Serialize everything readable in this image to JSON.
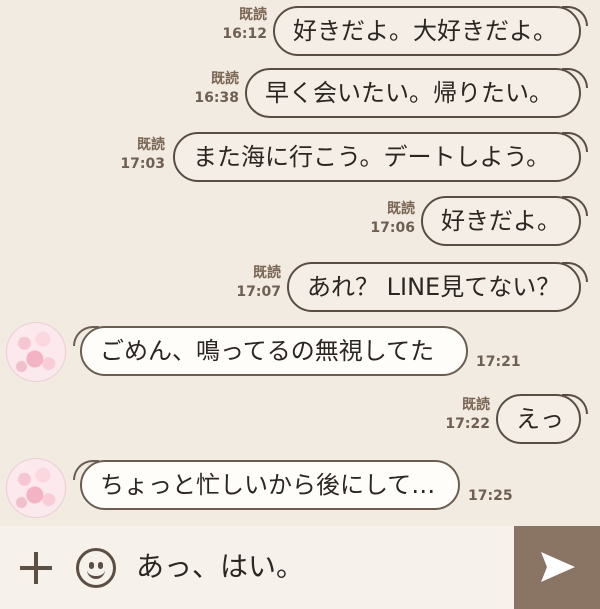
{
  "messages": [
    {
      "dir": "sent",
      "text": "好きだよ。大好きだよ。",
      "read": "既読",
      "time": "16:12"
    },
    {
      "dir": "sent",
      "text": "早く会いたい。帰りたい。",
      "read": "既読",
      "time": "16:38"
    },
    {
      "dir": "sent",
      "text": "また海に行こう。デートしよう。",
      "read": "既読",
      "time": "17:03"
    },
    {
      "dir": "sent",
      "text": "好きだよ。",
      "read": "既読",
      "time": "17:06"
    },
    {
      "dir": "sent",
      "text": "あれ？ LINE見てない？",
      "read": "既読",
      "time": "17:07"
    },
    {
      "dir": "recv",
      "text": "ごめん、鳴ってるの無視してた",
      "time": "17:21"
    },
    {
      "dir": "sent",
      "text": "えっ",
      "read": "既読",
      "time": "17:22"
    },
    {
      "dir": "recv",
      "text": "ちょっと忙しいから後にして…",
      "time": "17:25"
    }
  ],
  "composer": {
    "value": "あっ、はい。",
    "plus_icon": "plus-icon",
    "emoji_icon": "smiley-icon",
    "send_icon": "send-arrow-icon"
  },
  "colors": {
    "background": "#f1ebe2",
    "bubble_border": "#5a4e44",
    "send_button": "#8a7464"
  }
}
